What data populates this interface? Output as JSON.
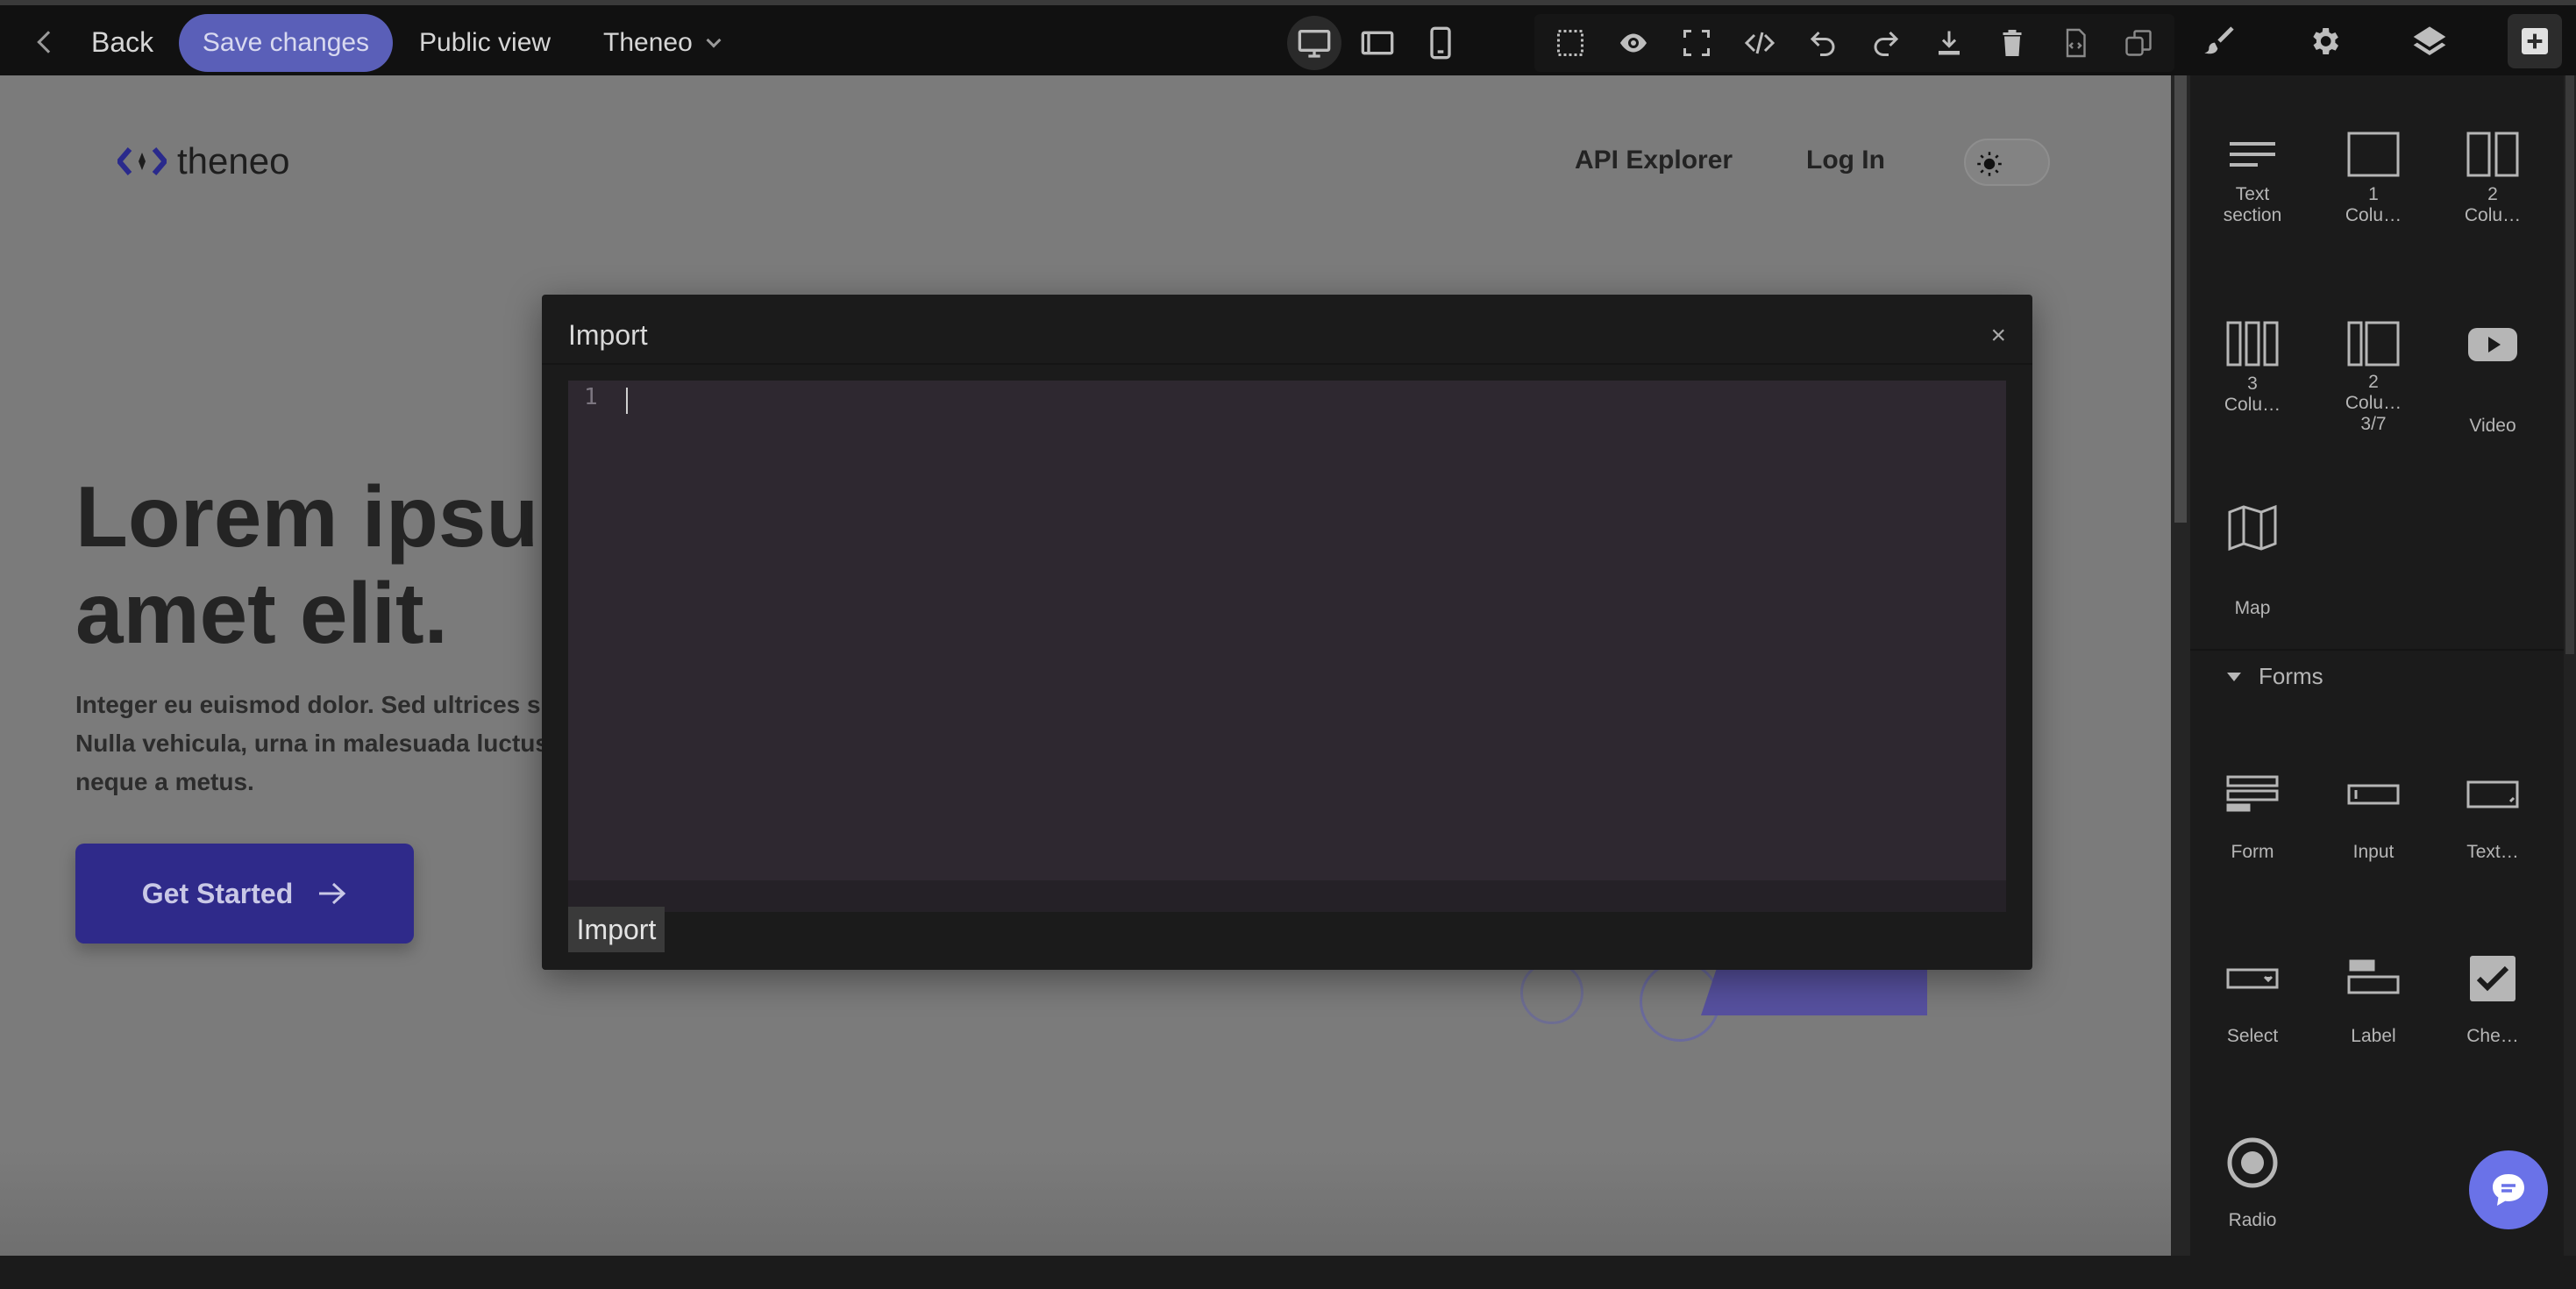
{
  "topbar": {
    "back_label": "Back",
    "save_label": "Save changes",
    "public_view_label": "Public view",
    "project_label": "Theneo"
  },
  "site": {
    "brand": "theneo",
    "nav_api": "API Explorer",
    "nav_login": "Log In",
    "hero_line1": "Lorem ipsum dolor sit",
    "hero_line2": "amet elit.",
    "body_line1": "Integer eu euismod dolor. Sed ultrices s",
    "body_line2": "Nulla vehicula, urna in malesuada luctus",
    "body_line3": "neque a metus.",
    "cta_label": "Get Started"
  },
  "modal": {
    "title": "Import",
    "close": "×",
    "line_number": "1",
    "import_button": "Import"
  },
  "panel": {
    "blocks": [
      {
        "label": "Text section",
        "icon": "text-section-icon"
      },
      {
        "label": "1 Colu…",
        "icon": "one-column-icon"
      },
      {
        "label": "2 Colu…",
        "icon": "two-column-icon"
      },
      {
        "label": "3 Colu…",
        "icon": "three-column-icon"
      },
      {
        "label": "2 Colu… 3/7",
        "icon": "two-column-37-icon"
      },
      {
        "label": "Video",
        "icon": "video-icon"
      },
      {
        "label": "Map",
        "icon": "map-icon"
      }
    ],
    "forms_header": "Forms",
    "form_blocks": [
      {
        "label": "Form",
        "icon": "form-icon"
      },
      {
        "label": "Input",
        "icon": "input-icon"
      },
      {
        "label": "Text…",
        "icon": "textarea-icon"
      },
      {
        "label": "Select",
        "icon": "select-icon"
      },
      {
        "label": "Label",
        "icon": "label-icon"
      },
      {
        "label": "Che…",
        "icon": "checkbox-icon"
      },
      {
        "label": "Radio",
        "icon": "radio-icon"
      }
    ]
  },
  "colors": {
    "save_button": "#5a5fb8",
    "cta": "#2f2a8a",
    "chat": "#6a72e8",
    "editor_bg": "#2e2830"
  }
}
